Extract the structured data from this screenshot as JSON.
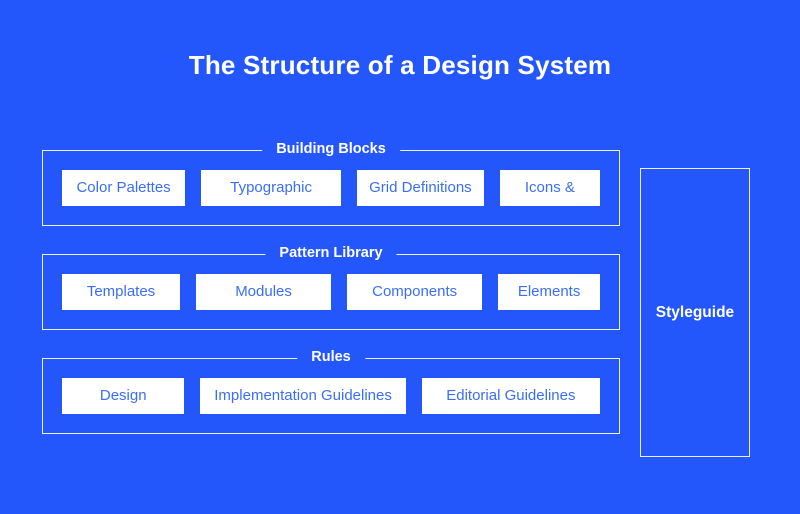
{
  "title": "The Structure of a Design System",
  "colors": {
    "background": "#2457fb",
    "chip_background": "#ffffff",
    "chip_text": "#3b6ef5",
    "border": "#ffffff",
    "title_text": "#ffffff"
  },
  "groups": [
    {
      "legend": "Building Blocks",
      "items": [
        {
          "label": "Color Palettes"
        },
        {
          "label": "Typographic"
        },
        {
          "label": "Grid Definitions"
        },
        {
          "label": "Icons &"
        }
      ]
    },
    {
      "legend": "Pattern Library",
      "items": [
        {
          "label": "Templates"
        },
        {
          "label": "Modules"
        },
        {
          "label": "Components"
        },
        {
          "label": "Elements"
        }
      ]
    },
    {
      "legend": "Rules",
      "items": [
        {
          "label": "Design"
        },
        {
          "label": "Implementation Guidelines"
        },
        {
          "label": "Editorial Guidelines"
        }
      ]
    }
  ],
  "styleguide": {
    "label": "Styleguide"
  }
}
